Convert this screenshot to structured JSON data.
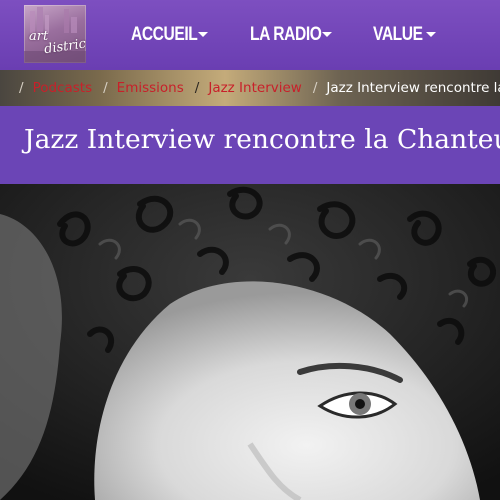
{
  "site": {
    "logo_text_line1": "art",
    "logo_text_line2": "district"
  },
  "nav": {
    "items": [
      {
        "label": "ACCUEIL",
        "has_dropdown": true
      },
      {
        "label": "LA RADIO",
        "has_dropdown": true
      },
      {
        "label": "VALUE",
        "has_dropdown": true
      }
    ]
  },
  "breadcrumb": {
    "home_icon": "home-icon",
    "separator": "/",
    "items": [
      {
        "label": "Podcasts"
      },
      {
        "label": "Emissions"
      },
      {
        "label": "Jazz Interview"
      }
    ],
    "current": "Jazz Interview rencontre la Chanteuse"
  },
  "page": {
    "title": "Jazz Interview rencontre la Chanteuse"
  },
  "colors": {
    "header_purple": "#7d4fc0",
    "title_band_purple": "#6b45b6",
    "breadcrumb_link_red": "#c8202a",
    "white": "#ffffff"
  }
}
